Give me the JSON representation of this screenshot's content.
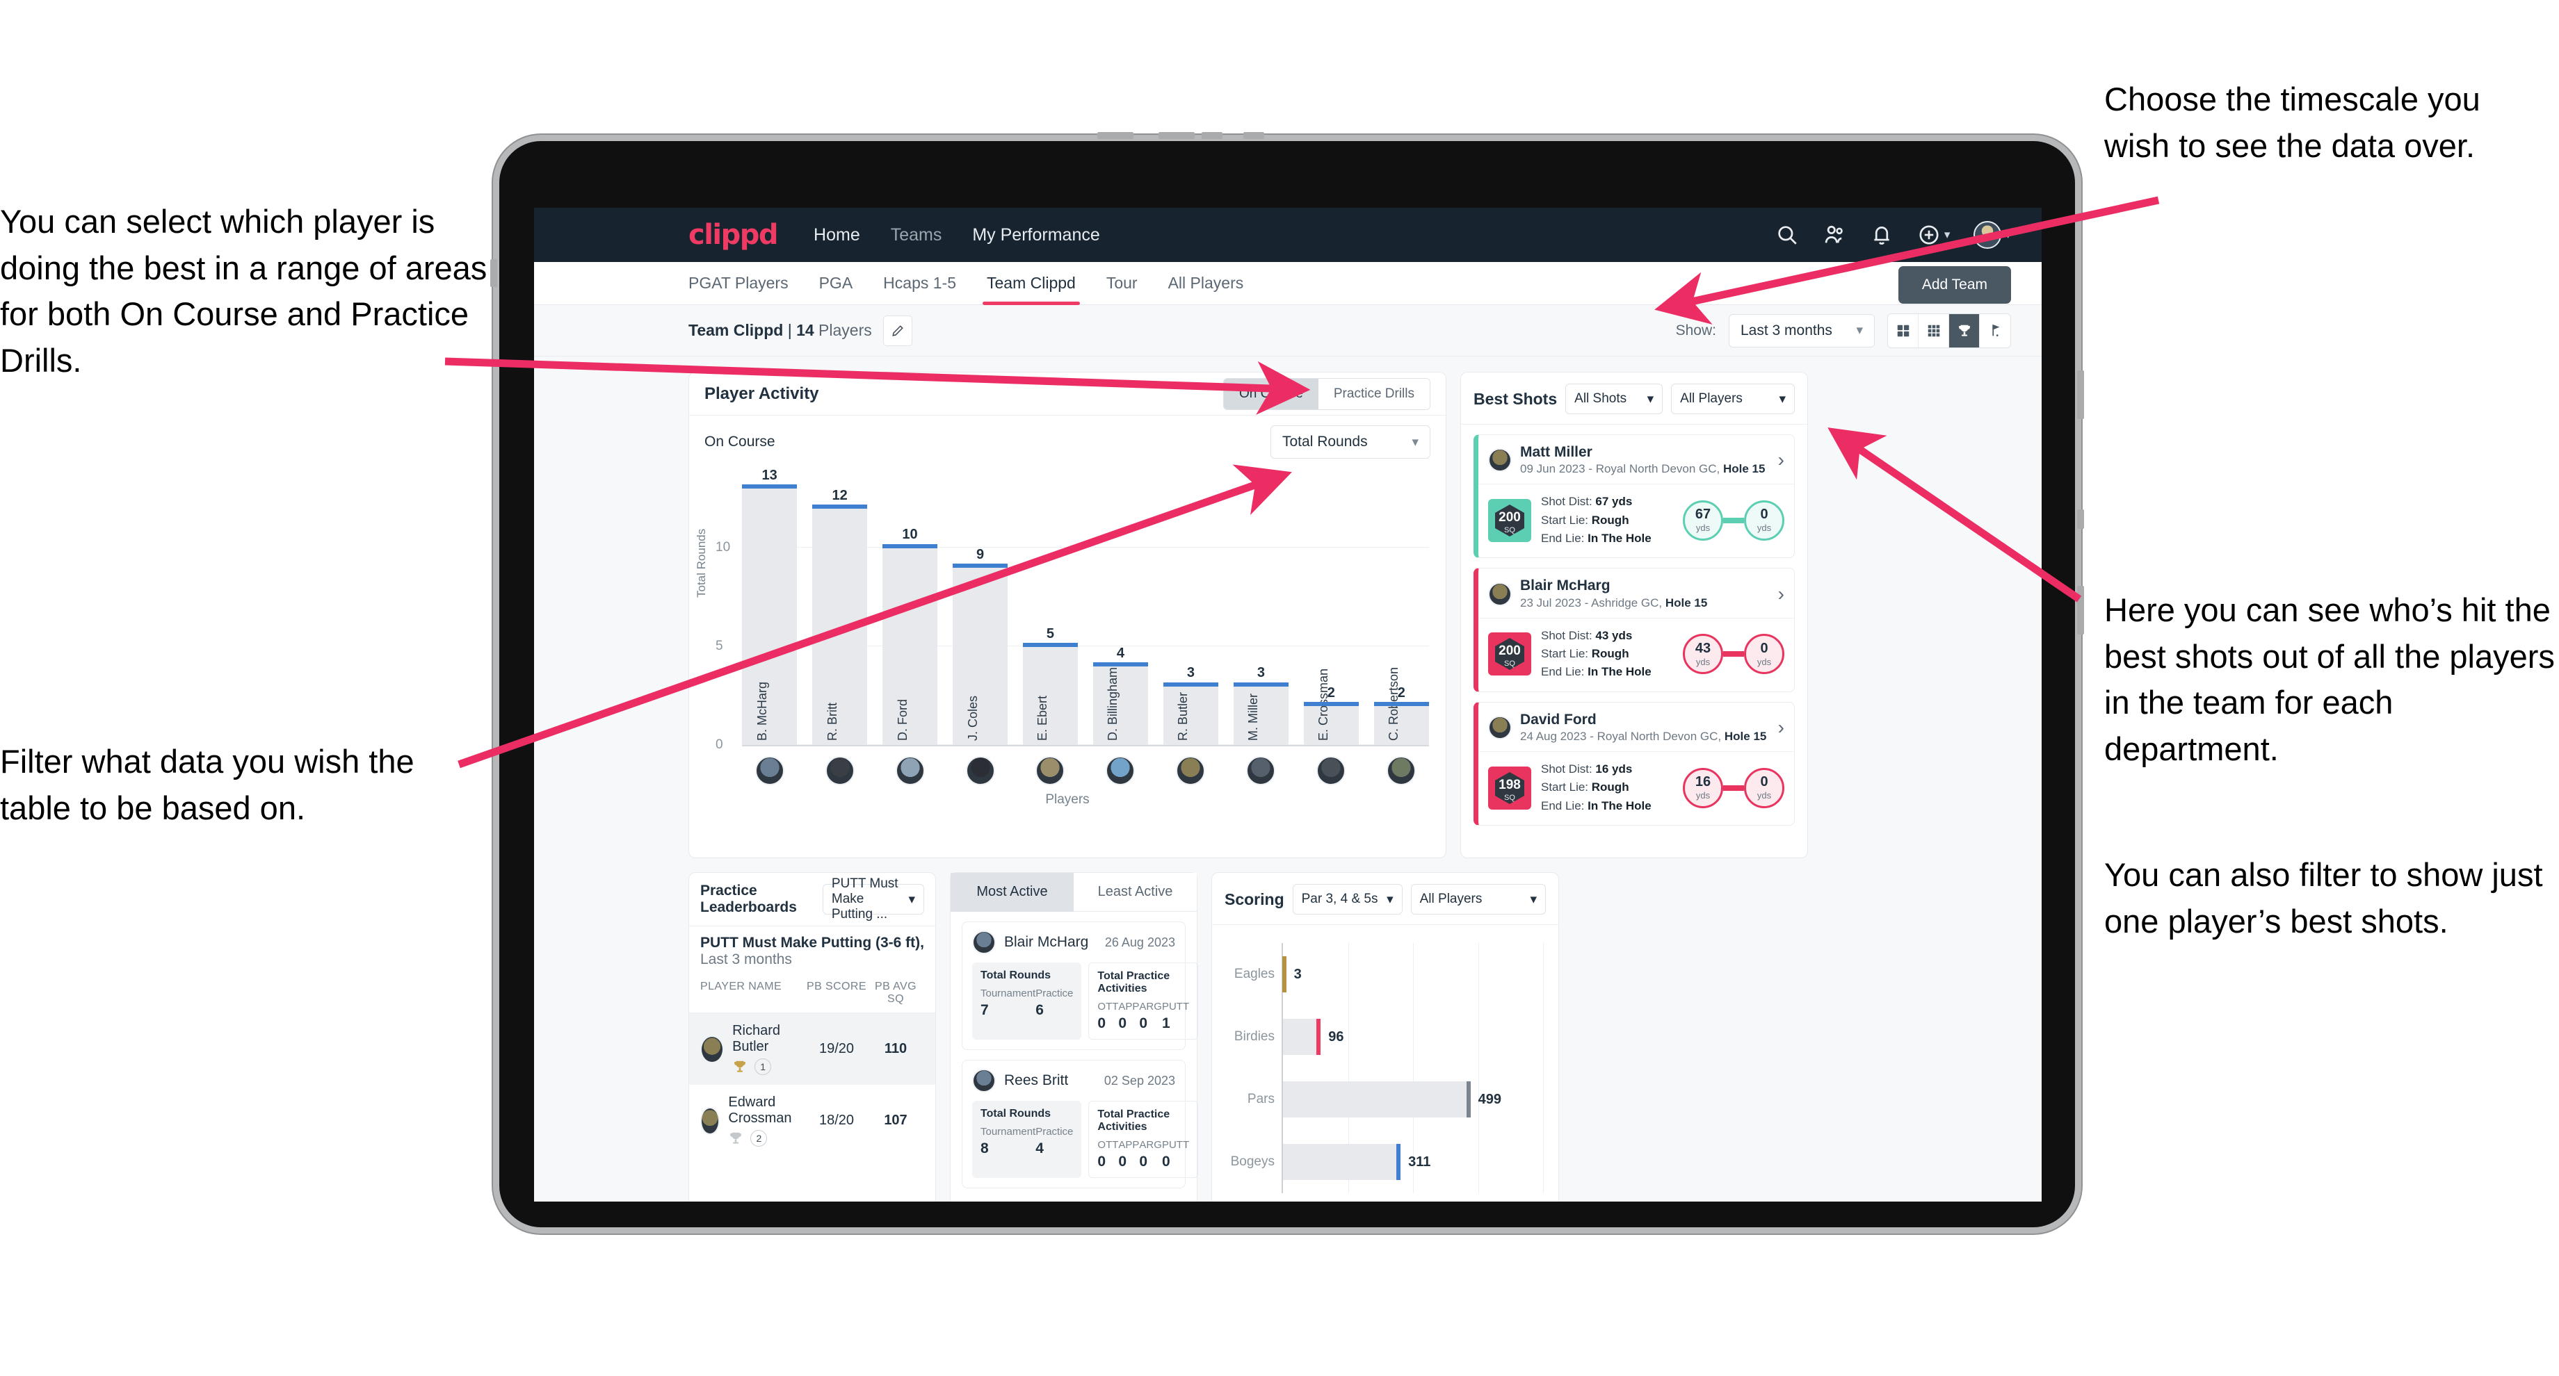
{
  "annotations": {
    "left_top": "You can select which player is doing the best in a range of areas for both On Course and Practice Drills.",
    "left_bottom": "Filter what data you wish the table to be based on.",
    "right_top": "Choose the timescale you wish to see the data over.",
    "right_mid": "Here you can see who’s hit the best shots out of all the players in the team for each department.",
    "right_bottom": "You can also filter to show just one player’s best shots."
  },
  "topnav": {
    "brand": "clippd",
    "links": [
      {
        "label": "Home",
        "active": true
      },
      {
        "label": "Teams",
        "active": false
      },
      {
        "label": "My Performance",
        "active": true
      }
    ],
    "icons": [
      "search-icon",
      "people-icon",
      "bell-icon",
      "plus-circle-icon",
      "user-avatar"
    ]
  },
  "tabs": {
    "items": [
      {
        "label": "PGAT Players",
        "active": false
      },
      {
        "label": "PGA",
        "active": false
      },
      {
        "label": "Hcaps 1-5",
        "active": false
      },
      {
        "label": "Team Clippd",
        "active": true
      },
      {
        "label": "Tour",
        "active": false
      },
      {
        "label": "All Players",
        "active": false
      }
    ],
    "add_team_label": "Add Team"
  },
  "subbar": {
    "team_name": "Team Clippd",
    "separator": " | ",
    "player_count": "14",
    "players_word": " Players",
    "show_label": "Show:",
    "timescale_value": "Last 3 months",
    "view_icons": [
      "grid-2x2-icon",
      "grid-3x3-icon",
      "trophy-icon",
      "golf-flag-icon"
    ],
    "active_view_index": 2
  },
  "player_activity": {
    "title": "Player Activity",
    "segments": [
      {
        "label": "On Course",
        "active": true
      },
      {
        "label": "Practice Drills",
        "active": false
      }
    ],
    "subtitle": "On Course",
    "metric_value": "Total Rounds"
  },
  "best_shots": {
    "title": "Best Shots",
    "filter_shots": "All Shots",
    "filter_players": "All Players",
    "shots": [
      {
        "player": "Matt Miller",
        "meta_date": "09 Jun 2023 - Royal North Devon GC, ",
        "meta_hole": "Hole 15",
        "sq_value": "200",
        "sq_unit": "SQ",
        "shot_dist_label": "Shot Dist: ",
        "shot_dist_value": "67 yds",
        "start_lie_label": "Start Lie: ",
        "start_lie_value": "Rough",
        "end_lie_label": "End Lie: ",
        "end_lie_value": "In The Hole",
        "from_value": "67",
        "from_unit": "yds",
        "to_value": "0",
        "to_unit": "yds",
        "accent": "#5ccfb3"
      },
      {
        "player": "Blair McHarg",
        "meta_date": "23 Jul 2023 - Ashridge GC, ",
        "meta_hole": "Hole 15",
        "sq_value": "200",
        "sq_unit": "SQ",
        "shot_dist_label": "Shot Dist: ",
        "shot_dist_value": "43 yds",
        "start_lie_label": "Start Lie: ",
        "start_lie_value": "Rough",
        "end_lie_label": "End Lie: ",
        "end_lie_value": "In The Hole",
        "from_value": "43",
        "from_unit": "yds",
        "to_value": "0",
        "to_unit": "yds",
        "accent": "#e8345e"
      },
      {
        "player": "David Ford",
        "meta_date": "24 Aug 2023 - Royal North Devon GC, ",
        "meta_hole": "Hole 15",
        "sq_value": "198",
        "sq_unit": "SQ",
        "shot_dist_label": "Shot Dist: ",
        "shot_dist_value": "16 yds",
        "start_lie_label": "Start Lie: ",
        "start_lie_value": "Rough",
        "end_lie_label": "End Lie: ",
        "end_lie_value": "In The Hole",
        "from_value": "16",
        "from_unit": "yds",
        "to_value": "0",
        "to_unit": "yds",
        "accent": "#e8345e"
      }
    ]
  },
  "practice_leaderboards": {
    "title": "Practice Leaderboards",
    "drill_select": "PUTT Must Make Putting ...",
    "drill_name": "PUTT Must Make Putting (3-6 ft),",
    "drill_period": " Last 3 months",
    "columns": [
      "PLAYER NAME",
      "PB SCORE",
      "PB AVG SQ"
    ],
    "rows": [
      {
        "name": "Richard Butler",
        "rank": "1",
        "pb_score": "19/20",
        "pb_avg_sq": "110",
        "trophy": "gold"
      },
      {
        "name": "Edward Crossman",
        "rank": "2",
        "pb_score": "18/20",
        "pb_avg_sq": "107",
        "trophy": "silver"
      }
    ]
  },
  "activity_panel": {
    "tabs": [
      {
        "label": "Most Active",
        "active": true
      },
      {
        "label": "Least Active",
        "active": false
      }
    ],
    "cards": [
      {
        "name": "Blair McHarg",
        "date": "26 Aug 2023",
        "rounds_title": "Total Rounds",
        "rounds": [
          {
            "key": "Tournament",
            "value": "7"
          },
          {
            "key": "Practice",
            "value": "6"
          }
        ],
        "practice_title": "Total Practice Activities",
        "practice": [
          {
            "key": "OTT",
            "value": "0"
          },
          {
            "key": "APP",
            "value": "0"
          },
          {
            "key": "ARG",
            "value": "0"
          },
          {
            "key": "PUTT",
            "value": "1"
          }
        ]
      },
      {
        "name": "Rees Britt",
        "date": "02 Sep 2023",
        "rounds_title": "Total Rounds",
        "rounds": [
          {
            "key": "Tournament",
            "value": "8"
          },
          {
            "key": "Practice",
            "value": "4"
          }
        ],
        "practice_title": "Total Practice Activities",
        "practice": [
          {
            "key": "OTT",
            "value": "0"
          },
          {
            "key": "APP",
            "value": "0"
          },
          {
            "key": "ARG",
            "value": "0"
          },
          {
            "key": "PUTT",
            "value": "0"
          }
        ]
      }
    ]
  },
  "scoring": {
    "title": "Scoring",
    "filter_par": "Par 3, 4 & 5s",
    "filter_players": "All Players"
  },
  "colors": {
    "brand_pink": "#ef3b63",
    "nav_dark": "#17242f",
    "bar_blue": "#3f7fd0",
    "teal": "#5ccfb3",
    "gold": "#b5923f",
    "arrow_pink": "#ec2d63"
  },
  "chart_data": [
    {
      "type": "bar",
      "title": "Player Activity – On Course",
      "xlabel": "Players",
      "ylabel": "Total Rounds",
      "ylim": [
        0,
        14
      ],
      "yticks": [
        0,
        5,
        10
      ],
      "grid": true,
      "categories": [
        "B. McHarg",
        "R. Britt",
        "D. Ford",
        "J. Coles",
        "E. Ebert",
        "D. Billingham",
        "R. Butler",
        "M. Miller",
        "E. Crossman",
        "C. Robertson"
      ],
      "values": [
        13,
        12,
        10,
        9,
        5,
        4,
        3,
        3,
        2,
        2
      ]
    },
    {
      "type": "bar",
      "orientation": "horizontal",
      "title": "Scoring",
      "xlabel": "",
      "ylabel": "",
      "xlim": [
        0,
        700
      ],
      "grid": true,
      "categories": [
        "Eagles",
        "Birdies",
        "Pars",
        "Bogeys"
      ],
      "values": [
        3,
        96,
        499,
        311
      ],
      "colors": [
        "#b5923f",
        "#ef3b63",
        "#7b8590",
        "#3f7fd0"
      ]
    }
  ]
}
